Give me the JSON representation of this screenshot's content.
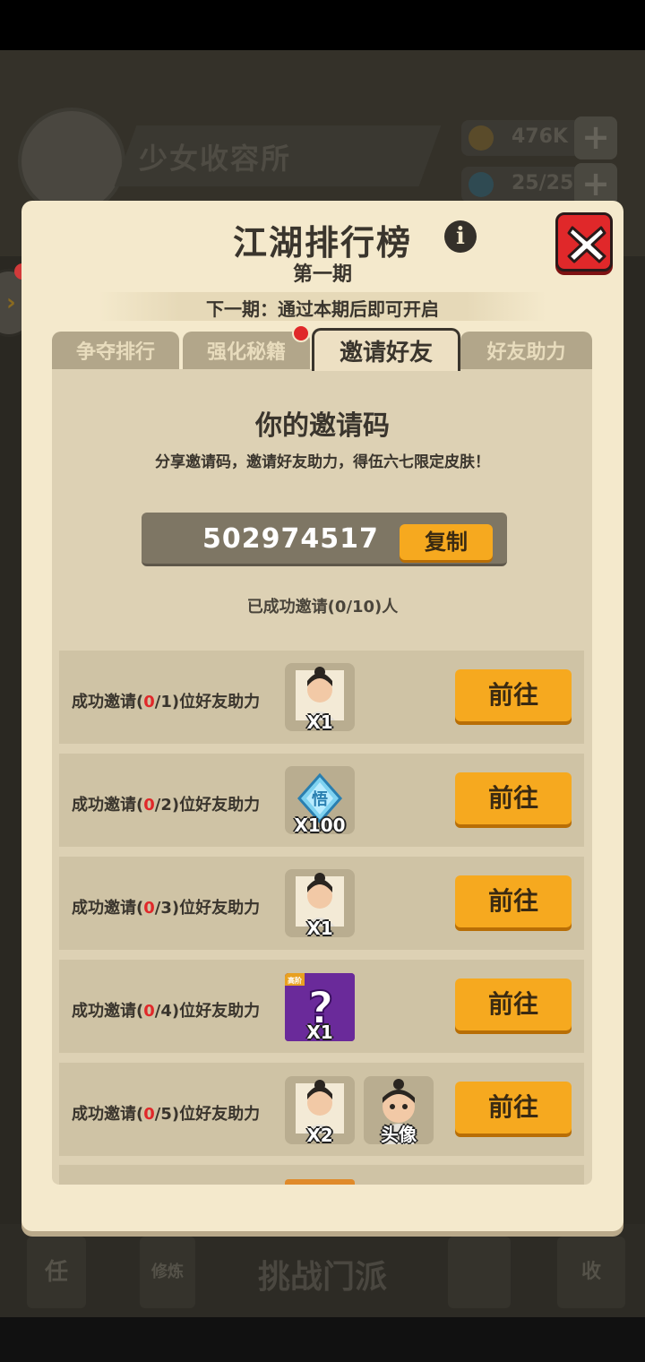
{
  "background": {
    "shelter_name": "少女收容所",
    "resources": [
      {
        "value": "476K",
        "icon": "coin-icon",
        "color": "#5a4b2a"
      },
      {
        "value": "25/25",
        "icon": "gem-icon",
        "color": "#2f4a52"
      }
    ],
    "bottom_nav": {
      "challenge_label": "挑战门派",
      "task_label": "任",
      "scroll_label": "修炼",
      "shop_label": "收"
    }
  },
  "dialog": {
    "title": "江湖排行榜",
    "period": "第一期",
    "notice": "下一期：通过本期后即可开启",
    "tabs": [
      {
        "label": "争夺排行",
        "active": false
      },
      {
        "label": "强化秘籍",
        "active": false,
        "badge": true
      },
      {
        "label": "邀请好友",
        "active": true
      },
      {
        "label": "好友助力",
        "active": false
      }
    ],
    "invite": {
      "title": "你的邀请码",
      "description": "分享邀请码，邀请好友助力，得伍六七限定皮肤！",
      "code": "502974517",
      "copy_label": "复制",
      "success_count": "已成功邀请(0/10)人"
    },
    "rows": [
      {
        "prefix": "成功邀请(",
        "done": "0",
        "target": "/1)位好友助力",
        "rewards": [
          {
            "type": "character-card-icon",
            "qty": "X1"
          }
        ],
        "button": "前往"
      },
      {
        "prefix": "成功邀请(",
        "done": "0",
        "target": "/2)位好友助力",
        "rewards": [
          {
            "type": "wu-gem-icon",
            "qty": "X100",
            "symbol": "悟"
          }
        ],
        "button": "前往"
      },
      {
        "prefix": "成功邀请(",
        "done": "0",
        "target": "/3)位好友助力",
        "rewards": [
          {
            "type": "character-card-icon",
            "qty": "X1"
          }
        ],
        "button": "前往"
      },
      {
        "prefix": "成功邀请(",
        "done": "0",
        "target": "/4)位好友助力",
        "rewards": [
          {
            "type": "mystery-box-icon",
            "qty": "X1",
            "corner": "高阶"
          }
        ],
        "button": "前往"
      },
      {
        "prefix": "成功邀请(",
        "done": "0",
        "target": "/5)位好友助力",
        "rewards": [
          {
            "type": "character-card-icon",
            "qty": "X2"
          },
          {
            "type": "avatar-reward-icon",
            "qty": "头像"
          }
        ],
        "button": "前往"
      }
    ]
  },
  "colors": {
    "panel": "#f4e9cc",
    "button": "#f6a91f",
    "close": "#e0282a",
    "progress_red": "#e0282a"
  }
}
